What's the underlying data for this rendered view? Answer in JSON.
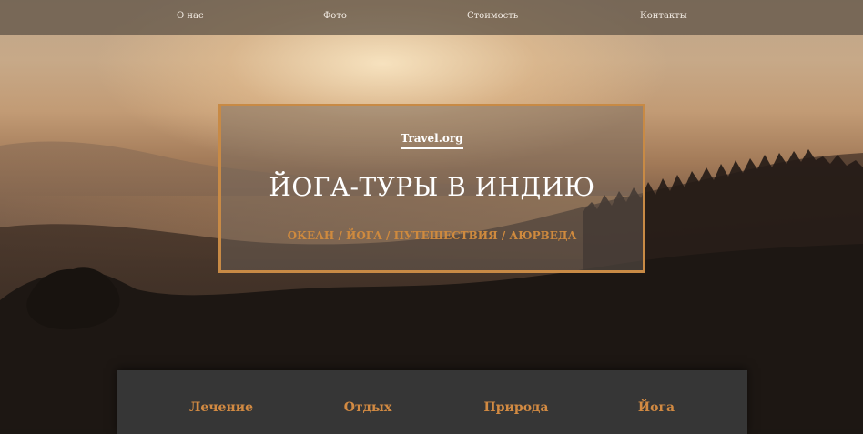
{
  "nav": {
    "items": [
      {
        "label": "О нас"
      },
      {
        "label": "Фото"
      },
      {
        "label": "Стоимость"
      },
      {
        "label": "Контакты"
      }
    ]
  },
  "hero": {
    "brand": "Travel.org",
    "title": "ЙОГА-ТУРЫ В ИНДИЮ",
    "subtitle": "ОКЕАН / ЙОГА / ПУТЕШЕСТВИЯ / АЮРВЕДА"
  },
  "features": {
    "items": [
      {
        "label": "Лечение"
      },
      {
        "label": "Отдых"
      },
      {
        "label": "Природа"
      },
      {
        "label": "Йога"
      }
    ]
  },
  "colors": {
    "accent": "#cf8a3e",
    "nav_bg": "#5c5044",
    "panel_bg": "#363636",
    "text_light": "#ffffff"
  }
}
